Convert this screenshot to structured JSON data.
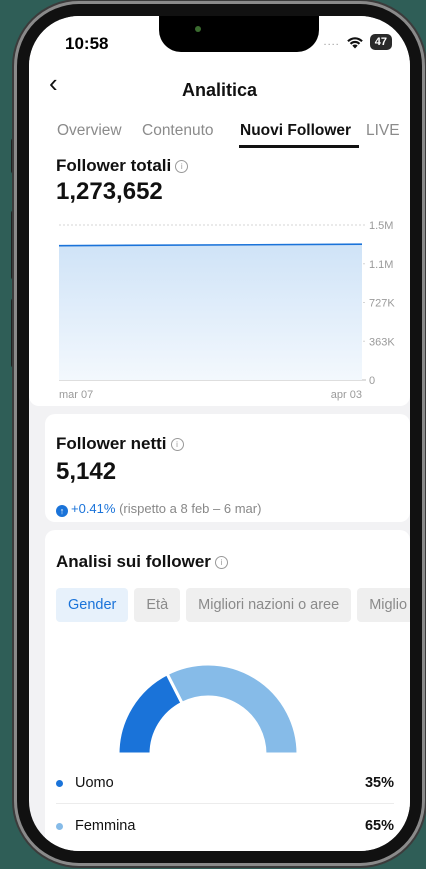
{
  "status": {
    "time": "10:58",
    "signal": "....",
    "battery": "47"
  },
  "header": {
    "back_icon": "chevron-left-icon",
    "title": "Analitica"
  },
  "tabs": [
    {
      "label": "Overview"
    },
    {
      "label": "Contenuto"
    },
    {
      "label": "Nuovi Follower",
      "active": true
    },
    {
      "label": "LIVE"
    }
  ],
  "total_followers": {
    "title": "Follower totali",
    "value": "1,273,652",
    "chart_data": {
      "type": "area",
      "x": [
        "mar 07",
        "apr 03"
      ],
      "values": [
        1260000,
        1273652
      ],
      "y_ticks": [
        "1.5M",
        "1.1M",
        "727K",
        "363K",
        "0"
      ],
      "ylim": [
        0,
        1454000
      ],
      "x_tick_labels": [
        "mar 07",
        "apr 03"
      ],
      "grid": true,
      "color": "#1a73d9"
    }
  },
  "net_followers": {
    "title": "Follower netti",
    "value": "5,142",
    "delta_pct": "+0.41%",
    "delta_note": "(rispetto a 8 feb – 6 mar)"
  },
  "insights": {
    "title": "Analisi sui follower",
    "chips": [
      {
        "label": "Gender",
        "active": true
      },
      {
        "label": "Età"
      },
      {
        "label": "Migliori nazioni o aree"
      },
      {
        "label": "Miglio"
      }
    ],
    "chart_data": {
      "type": "pie",
      "categories": [
        "Uomo",
        "Femmina"
      ],
      "values": [
        35,
        65
      ],
      "colors": [
        "#1a73d9",
        "#86bbe8"
      ]
    },
    "legend": [
      {
        "label": "Uomo",
        "value": "35%",
        "color": "#1a73d9"
      },
      {
        "label": "Femmina",
        "value": "65%",
        "color": "#86bbe8"
      }
    ]
  }
}
